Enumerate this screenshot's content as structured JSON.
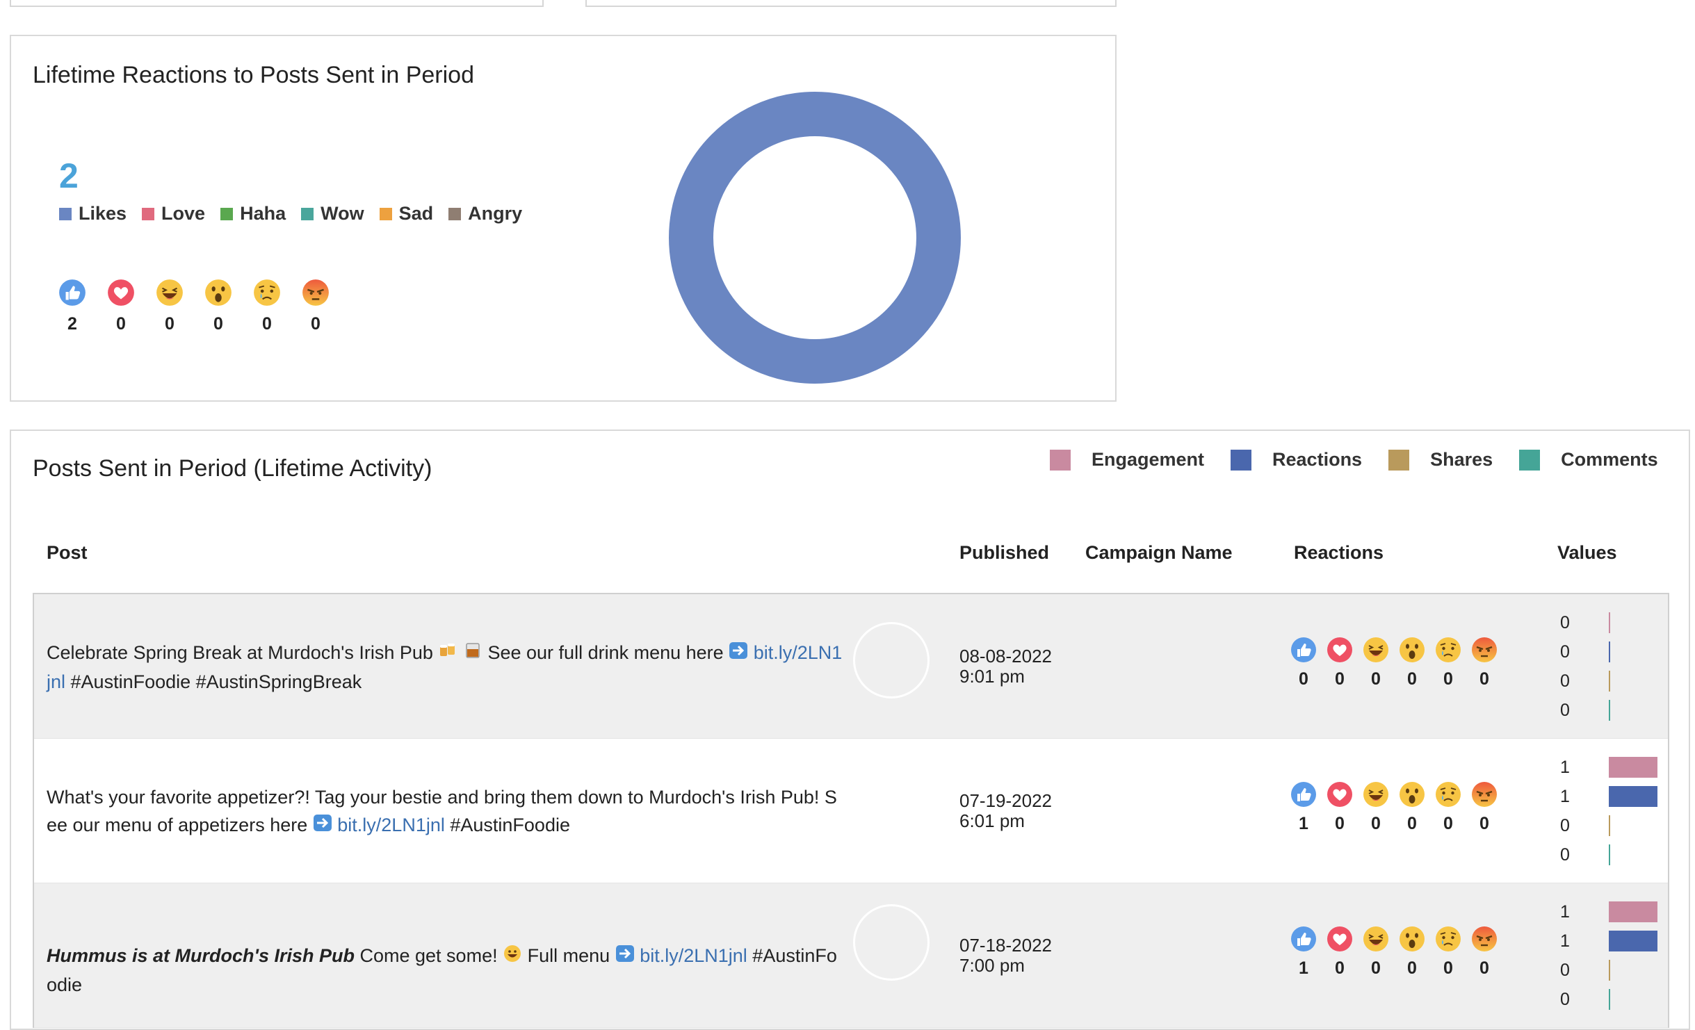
{
  "reactions_card": {
    "title": "Lifetime Reactions to Posts Sent in Period",
    "total": "2",
    "legend": [
      {
        "label": "Likes",
        "color": "#6a86c2"
      },
      {
        "label": "Love",
        "color": "#e06a7e"
      },
      {
        "label": "Haha",
        "color": "#5aa84f"
      },
      {
        "label": "Wow",
        "color": "#4aa69c"
      },
      {
        "label": "Sad",
        "color": "#eda13f"
      },
      {
        "label": "Angry",
        "color": "#8f7e72"
      }
    ],
    "counts": [
      {
        "icon": "like-icon",
        "value": "2"
      },
      {
        "icon": "love-icon",
        "value": "0"
      },
      {
        "icon": "haha-icon",
        "value": "0"
      },
      {
        "icon": "wow-icon",
        "value": "0"
      },
      {
        "icon": "sad-icon",
        "value": "0"
      },
      {
        "icon": "angry-icon",
        "value": "0"
      }
    ]
  },
  "chart_data": {
    "type": "pie",
    "categories": [
      "Likes",
      "Love",
      "Haha",
      "Wow",
      "Sad",
      "Angry"
    ],
    "values": [
      2,
      0,
      0,
      0,
      0,
      0
    ],
    "colors": [
      "#6a86c2",
      "#e06a7e",
      "#5aa84f",
      "#4aa69c",
      "#eda13f",
      "#8f7e72"
    ],
    "donut": true,
    "legend": "left"
  },
  "posts_card": {
    "title": "Posts Sent in Period (Lifetime Activity)",
    "series_legend": [
      {
        "label": "Engagement",
        "color": "#c98aa0"
      },
      {
        "label": "Reactions",
        "color": "#4a67ad"
      },
      {
        "label": "Shares",
        "color": "#b99a5c"
      },
      {
        "label": "Comments",
        "color": "#45a597"
      }
    ],
    "columns": {
      "post": "Post",
      "published": "Published",
      "campaign": "Campaign Name",
      "reactions": "Reactions",
      "values": "Values"
    },
    "rows": [
      {
        "text_before": "Celebrate Spring Break at Murdoch's Irish Pub",
        "text_mid": "See our full drink menu here",
        "link": "bit.ly/2LN1jnl",
        "text_after": "#AustinFoodie #AustinSpringBreak",
        "date": "08-08-2022",
        "time": "9:01 pm",
        "reactions": [
          "0",
          "0",
          "0",
          "0",
          "0",
          "0"
        ],
        "values": {
          "engagement": 0,
          "reactions": 0,
          "shares": 0,
          "comments": 0
        },
        "value_labels": [
          "0",
          "0",
          "0",
          "0"
        ]
      },
      {
        "text_before": "What's your favorite appetizer?! Tag your bestie and bring them down to Murdoch's Irish Pub! See our menu of appetizers here",
        "link": "bit.ly/2LN1jnl",
        "text_after": "#AustinFoodie",
        "date": "07-19-2022",
        "time": "6:01 pm",
        "reactions": [
          "1",
          "0",
          "0",
          "0",
          "0",
          "0"
        ],
        "values": {
          "engagement": 1,
          "reactions": 1,
          "shares": 0,
          "comments": 0
        },
        "value_labels": [
          "1",
          "1",
          "0",
          "0"
        ]
      },
      {
        "text_bold": "Hummus is at Murdoch's Irish Pub",
        "text_before": "Come get some!",
        "text_mid": "Full menu",
        "link": "bit.ly/2LN1jnl",
        "text_after": "#AustinFoodie",
        "date": "07-18-2022",
        "time": "7:00 pm",
        "reactions": [
          "1",
          "0",
          "0",
          "0",
          "0",
          "0"
        ],
        "values": {
          "engagement": 1,
          "reactions": 1,
          "shares": 0,
          "comments": 0
        },
        "value_labels": [
          "1",
          "1",
          "0",
          "0"
        ]
      }
    ]
  }
}
